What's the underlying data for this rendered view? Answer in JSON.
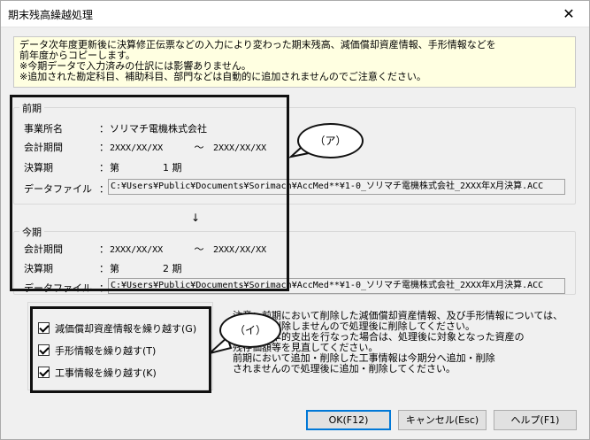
{
  "window": {
    "title": "期末残高繰越処理"
  },
  "notice": [
    "データ次年度更新後に決算修正伝票などの入力により変わった期末残高、減価償却資産情報、手形情報などを",
    "前年度からコピーします。",
    "※今期データで入力済みの仕訳には影響ありません。",
    "※追加された勘定科目、補助科目、部門などは自動的に追加されませんのでご注意ください。"
  ],
  "previous": {
    "label": "前期",
    "office_label": "事業所名",
    "office_value": "ソリマチ電機株式会社",
    "period_label": "会計期間",
    "period_start": "2XXX/XX/XX",
    "period_sep": "～",
    "period_end": "2XXX/XX/XX",
    "term_label": "決算期",
    "term_prefix": "第",
    "term_value": "1 期",
    "file_label": "データファイル",
    "file_value": "C:¥Users¥Public¥Documents¥Sorimach¥AccMed**¥1-0_ソリマチ電機株式会社_2XXX年X月決算.ACC"
  },
  "colon": "：",
  "arrow": "↓",
  "current": {
    "label": "今期",
    "period_label": "会計期間",
    "period_start": "2XXX/XX/XX",
    "period_sep": "～",
    "period_end": "2XXX/XX/XX",
    "term_label": "決算期",
    "term_prefix": "第",
    "term_value": "2 期",
    "file_label": "データファイル",
    "file_value": "C:¥Users¥Public¥Documents¥Sorimach¥AccMed**¥1-0_ソリマチ電機株式会社_2XXX年X月決算.ACC"
  },
  "callouts": {
    "a": "（ア）",
    "b": "（イ）"
  },
  "options": [
    {
      "label": "減価償却資産情報を繰り越す(G)",
      "checked": true
    },
    {
      "label": "手形情報を繰り越す(T)",
      "checked": true
    },
    {
      "label": "工事情報を繰り越す(K)",
      "checked": true
    }
  ],
  "note": [
    "注意：前期において削除した減価償却資産情報、及び手形情報については、",
    "今期から削除しませんので処理後に削除してください。",
    "前期に資本的支出を行なった場合は、処理後に対象となった資産の",
    "残存価額等を見直してください。",
    "前期において追加・削除した工事情報は今期分へ追加・削除",
    "されませんので処理後に追加・削除してください。"
  ],
  "buttons": {
    "ok": "OK(F12)",
    "cancel": "キャンセル(Esc)",
    "help": "ヘルプ(F1)"
  }
}
